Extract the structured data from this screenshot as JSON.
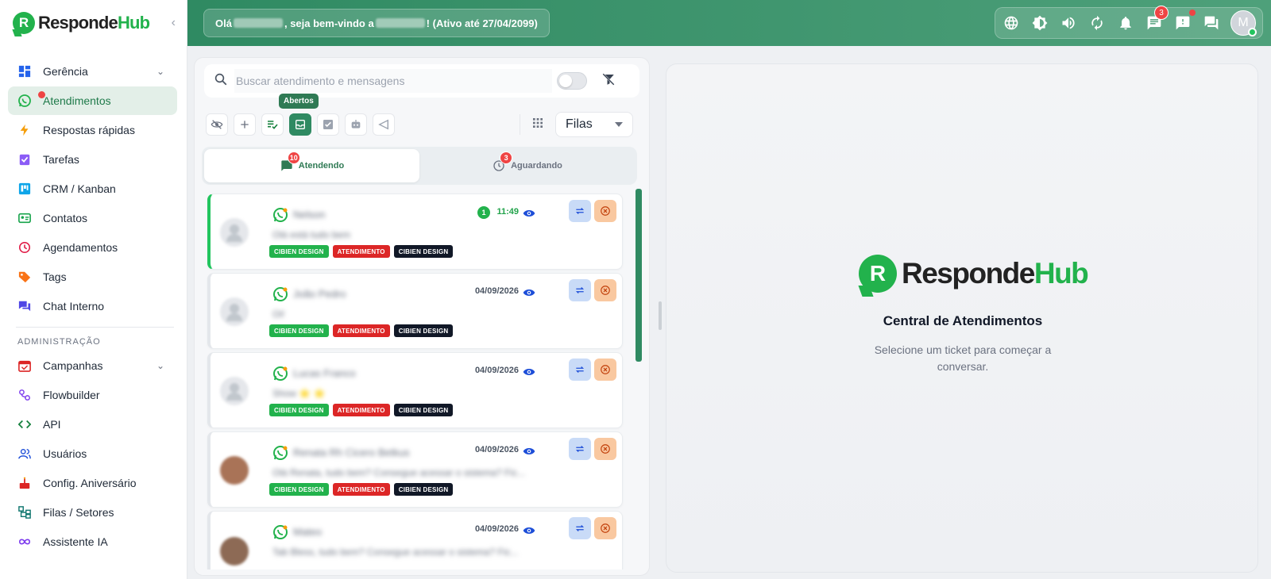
{
  "brand": {
    "name_part1": "Responde",
    "name_part2": "Hub",
    "mark": "R"
  },
  "header": {
    "welcome_prefix": "Olá",
    "welcome_mid": ", seja bem-vindo a",
    "welcome_suffix": "! (Ativo até 27/04/2099)",
    "chat_badge": "3",
    "avatar_initial": "M",
    "icons": [
      "globe-icon",
      "contrast-icon",
      "volume-icon",
      "refresh-icon",
      "bell-icon",
      "chat-icon",
      "alert-message-icon",
      "forum-icon"
    ]
  },
  "sidebar": {
    "items": [
      {
        "label": "Gerência",
        "icon": "dashboard-icon"
      },
      {
        "label": "Atendimentos",
        "icon": "whatsapp-icon"
      },
      {
        "label": "Respostas rápidas",
        "icon": "bolt-icon"
      },
      {
        "label": "Tarefas",
        "icon": "clipboard-check-icon"
      },
      {
        "label": "CRM / Kanban",
        "icon": "kanban-icon"
      },
      {
        "label": "Contatos",
        "icon": "contact-card-icon"
      },
      {
        "label": "Agendamentos",
        "icon": "clock-icon"
      },
      {
        "label": "Tags",
        "icon": "tag-icon"
      },
      {
        "label": "Chat Interno",
        "icon": "chat-bubbles-icon"
      }
    ],
    "admin_label": "ADMINISTRAÇÃO",
    "admin_items": [
      {
        "label": "Campanhas",
        "icon": "calendar-icon"
      },
      {
        "label": "Flowbuilder",
        "icon": "flow-icon"
      },
      {
        "label": "API",
        "icon": "code-icon"
      },
      {
        "label": "Usuários",
        "icon": "users-icon"
      },
      {
        "label": "Config. Aniversário",
        "icon": "cake-icon"
      },
      {
        "label": "Filas / Setores",
        "icon": "queue-icon"
      },
      {
        "label": "Assistente IA",
        "icon": "infinity-icon"
      }
    ]
  },
  "tickets": {
    "search_placeholder": "Buscar atendimento e mensagens",
    "tooltip": "Abertos",
    "queue_select": "Filas",
    "tabs": [
      {
        "label": "Atendendo",
        "badge": "10"
      },
      {
        "label": "Aguardando",
        "badge": "3"
      }
    ],
    "list": [
      {
        "name": "Nelson",
        "message": "Olá está tudo bem",
        "time": "11:49",
        "unread": "1",
        "tags": [
          "CIBIEN DESIGN",
          "ATENDIMENTO",
          "CIBIEN DESIGN"
        ]
      },
      {
        "name": "João Pedro",
        "message": "Oi!",
        "time": "04/09/2026",
        "tags": [
          "CIBIEN DESIGN",
          "ATENDIMENTO",
          "CIBIEN DESIGN"
        ]
      },
      {
        "name": "Lucas Franco",
        "message": "Show ⭐ ⭐",
        "time": "04/09/2026",
        "tags": [
          "CIBIEN DESIGN",
          "ATENDIMENTO",
          "CIBIEN DESIGN"
        ]
      },
      {
        "name": "Renata Rh Cicero Betkus",
        "message": "Olá Renata, tudo bem? Consegue acessar o sistema? Fic...",
        "time": "04/09/2026",
        "tags": [
          "CIBIEN DESIGN",
          "ATENDIMENTO",
          "CIBIEN DESIGN"
        ]
      },
      {
        "name": "Mateo",
        "message": "Tab Bless, tudo bem? Consegue acessar o sistema? Fic...",
        "time": "04/09/2026",
        "tags": []
      }
    ]
  },
  "empty_state": {
    "title": "Central de Atendimentos",
    "subtitle": "Selecione um ticket para começar a conversar."
  },
  "colors": {
    "primary": "#2f8a62",
    "brand_green": "#22b24c",
    "badge_red": "#ef4444",
    "tag_red": "#dc2626",
    "tag_dark": "#111827"
  }
}
